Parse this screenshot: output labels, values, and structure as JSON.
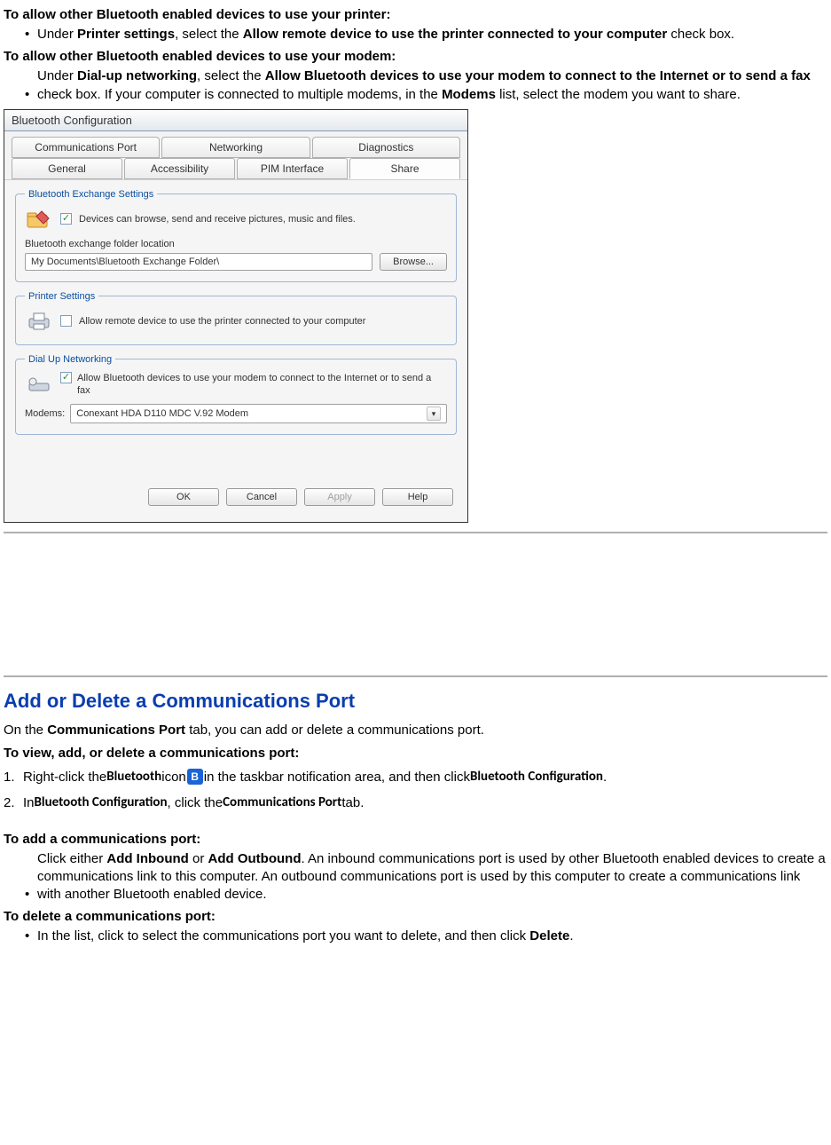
{
  "section1": {
    "printer_heading": "To allow other Bluetooth enabled devices to use your printer:",
    "printer_bullet_pre": "Under ",
    "printer_bullet_b1": "Printer settings",
    "printer_bullet_mid": ", select the ",
    "printer_bullet_b2": "Allow remote device to use the printer connected to your computer",
    "printer_bullet_post": " check box.",
    "modem_heading": "To allow other Bluetooth enabled devices to use your modem:",
    "modem_bullet_pre": "Under ",
    "modem_bullet_b1": "Dial-up networking",
    "modem_bullet_mid": ", select the ",
    "modem_bullet_b2": "Allow Bluetooth devices to use your modem to connect to the Internet or to send a fax",
    "modem_bullet_mid2": " check box. If your computer is connected to multiple modems, in the ",
    "modem_bullet_b3": "Modems",
    "modem_bullet_post": " list, select the modem you want to share."
  },
  "dialog": {
    "title": "Bluetooth Configuration",
    "tabs_row1": [
      "Communications Port",
      "Networking",
      "Diagnostics"
    ],
    "tabs_row2": [
      "General",
      "Accessibility",
      "PIM Interface",
      "Share"
    ],
    "active_tab": "Share",
    "exchange": {
      "legend": "Bluetooth Exchange Settings",
      "check_label": "Devices can browse, send and receive pictures, music and files.",
      "folder_label": "Bluetooth exchange folder location",
      "folder_value": "My Documents\\Bluetooth Exchange Folder\\",
      "browse": "Browse..."
    },
    "printer": {
      "legend": "Printer Settings",
      "check_label": "Allow remote device to use the printer connected to your computer"
    },
    "dialup": {
      "legend": "Dial Up Networking",
      "check_label": "Allow Bluetooth devices to use your modem to connect to the Internet or to send a fax",
      "modems_label": "Modems:",
      "modems_value": "Conexant HDA D110 MDC V.92 Modem"
    },
    "buttons": {
      "ok": "OK",
      "cancel": "Cancel",
      "apply": "Apply",
      "help": "Help"
    }
  },
  "section2": {
    "title": "Add or Delete a Communications Port",
    "intro_pre": "On the ",
    "intro_b": "Communications Port",
    "intro_post": " tab, you can add or delete a communications port.",
    "view_heading": "To view, add, or delete a communications port:",
    "step1_num": "1.",
    "step1_pre": "Right-click the ",
    "step1_b1": "Bluetooth",
    "step1_mid": " icon ",
    "step1_post": "in the taskbar notification area, and then click ",
    "step1_b2": "Bluetooth Configuration",
    "step1_dot": ".",
    "step2_num": "2.",
    "step2_pre": "In ",
    "step2_b1": "Bluetooth Configuration",
    "step2_mid": ", click the ",
    "step2_b2": "Communications Port",
    "step2_post": " tab.",
    "add_heading": "To add a communications port:",
    "add_bullet_pre": "Click either ",
    "add_bullet_b1": "Add Inbound",
    "add_bullet_or": " or ",
    "add_bullet_b2": "Add Outbound",
    "add_bullet_post": ". An inbound communications port is used by other Bluetooth enabled devices to create a communications link to this computer. An outbound communications port is used by this computer to create a communications link with another Bluetooth enabled device.",
    "del_heading": "To delete a communications port:",
    "del_bullet_pre": "In the list, click to select the communications port you want to delete, and then click ",
    "del_bullet_b": "Delete",
    "del_bullet_post": "."
  },
  "bullet_char": "•"
}
